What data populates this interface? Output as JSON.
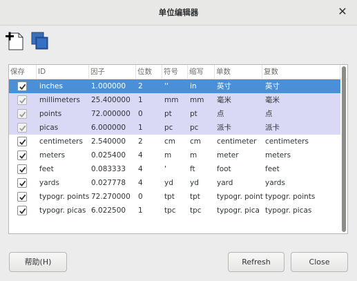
{
  "window": {
    "title": "单位编辑器"
  },
  "toolbar": {
    "new_icon": "new-unit-icon",
    "duplicate_icon": "duplicate-unit-icon"
  },
  "table": {
    "columns": [
      "保存",
      "ID",
      "因子",
      "位数",
      "符号",
      "缩写",
      "单数",
      "复数"
    ],
    "rows": [
      {
        "save": true,
        "id": "inches",
        "factor": "1.000000",
        "digits": "2",
        "symbol": "''",
        "abbr": "in",
        "singular": "英寸",
        "plural": "英寸",
        "state": "selected"
      },
      {
        "save": true,
        "id": "millimeters",
        "factor": "25.400000",
        "digits": "1",
        "symbol": "mm",
        "abbr": "mm",
        "singular": "毫米",
        "plural": "毫米",
        "state": "builtin"
      },
      {
        "save": true,
        "id": "points",
        "factor": "72.000000",
        "digits": "0",
        "symbol": "pt",
        "abbr": "pt",
        "singular": "点",
        "plural": "点",
        "state": "builtin"
      },
      {
        "save": true,
        "id": "picas",
        "factor": "6.000000",
        "digits": "1",
        "symbol": "pc",
        "abbr": "pc",
        "singular": "派卡",
        "plural": "派卡",
        "state": "builtin"
      },
      {
        "save": true,
        "id": "centimeters",
        "factor": "2.540000",
        "digits": "2",
        "symbol": "cm",
        "abbr": "cm",
        "singular": "centimeter",
        "plural": "centimeters",
        "state": "normal"
      },
      {
        "save": true,
        "id": "meters",
        "factor": "0.025400",
        "digits": "4",
        "symbol": "m",
        "abbr": "m",
        "singular": "meter",
        "plural": "meters",
        "state": "normal"
      },
      {
        "save": true,
        "id": "feet",
        "factor": "0.083333",
        "digits": "4",
        "symbol": "'",
        "abbr": "ft",
        "singular": "foot",
        "plural": "feet",
        "state": "normal"
      },
      {
        "save": true,
        "id": "yards",
        "factor": "0.027778",
        "digits": "4",
        "symbol": "yd",
        "abbr": "yd",
        "singular": "yard",
        "plural": "yards",
        "state": "normal"
      },
      {
        "save": true,
        "id": "typogr. points",
        "factor": "72.270000",
        "digits": "0",
        "symbol": "tpt",
        "abbr": "tpt",
        "singular": "typogr. point",
        "plural": "typogr. points",
        "state": "normal"
      },
      {
        "save": true,
        "id": "typogr. picas",
        "factor": "6.022500",
        "digits": "1",
        "symbol": "tpc",
        "abbr": "tpc",
        "singular": "typogr. pica",
        "plural": "typogr. picas",
        "state": "normal"
      }
    ]
  },
  "buttons": {
    "help": "帮助(H)",
    "refresh": "Refresh",
    "close": "Close"
  },
  "colors": {
    "selection": "#4a90d9",
    "builtin_row": "#d9d9f5"
  }
}
